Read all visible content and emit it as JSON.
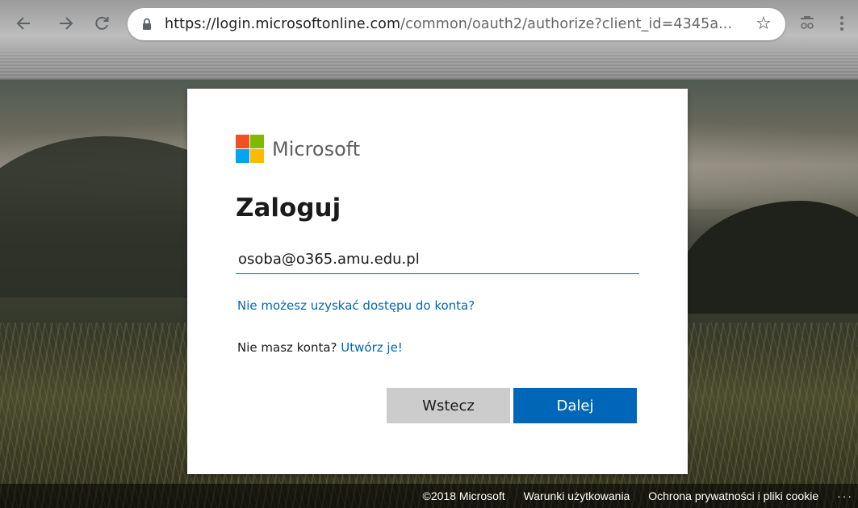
{
  "browser": {
    "url_host": "https://login.microsoftonline.com",
    "url_path": "/common/oauth2/authorize?client_id=4345a...",
    "icons": [
      "back-icon",
      "forward-icon",
      "reload-icon",
      "lock-icon",
      "star-icon",
      "extension-icon",
      "menu-icon"
    ]
  },
  "card": {
    "brand": "Microsoft",
    "title": "Zaloguj",
    "email_value": "osoba@o365.amu.edu.pl",
    "help_link": "Nie możesz uzyskać dostępu do konta?",
    "no_account_text": "Nie masz konta?",
    "create_link": "Utwórz je!",
    "back_button": "Wstecz",
    "next_button": "Dalej"
  },
  "footer": {
    "copyright": "©2018 Microsoft",
    "terms": "Warunki użytkowania",
    "privacy": "Ochrona prywatności i pliki cookie",
    "more": "···"
  },
  "colors": {
    "accent": "#0067b8",
    "logo_red": "#f25022",
    "logo_green": "#7fba00",
    "logo_blue": "#00a4ef",
    "logo_yellow": "#ffb900"
  }
}
